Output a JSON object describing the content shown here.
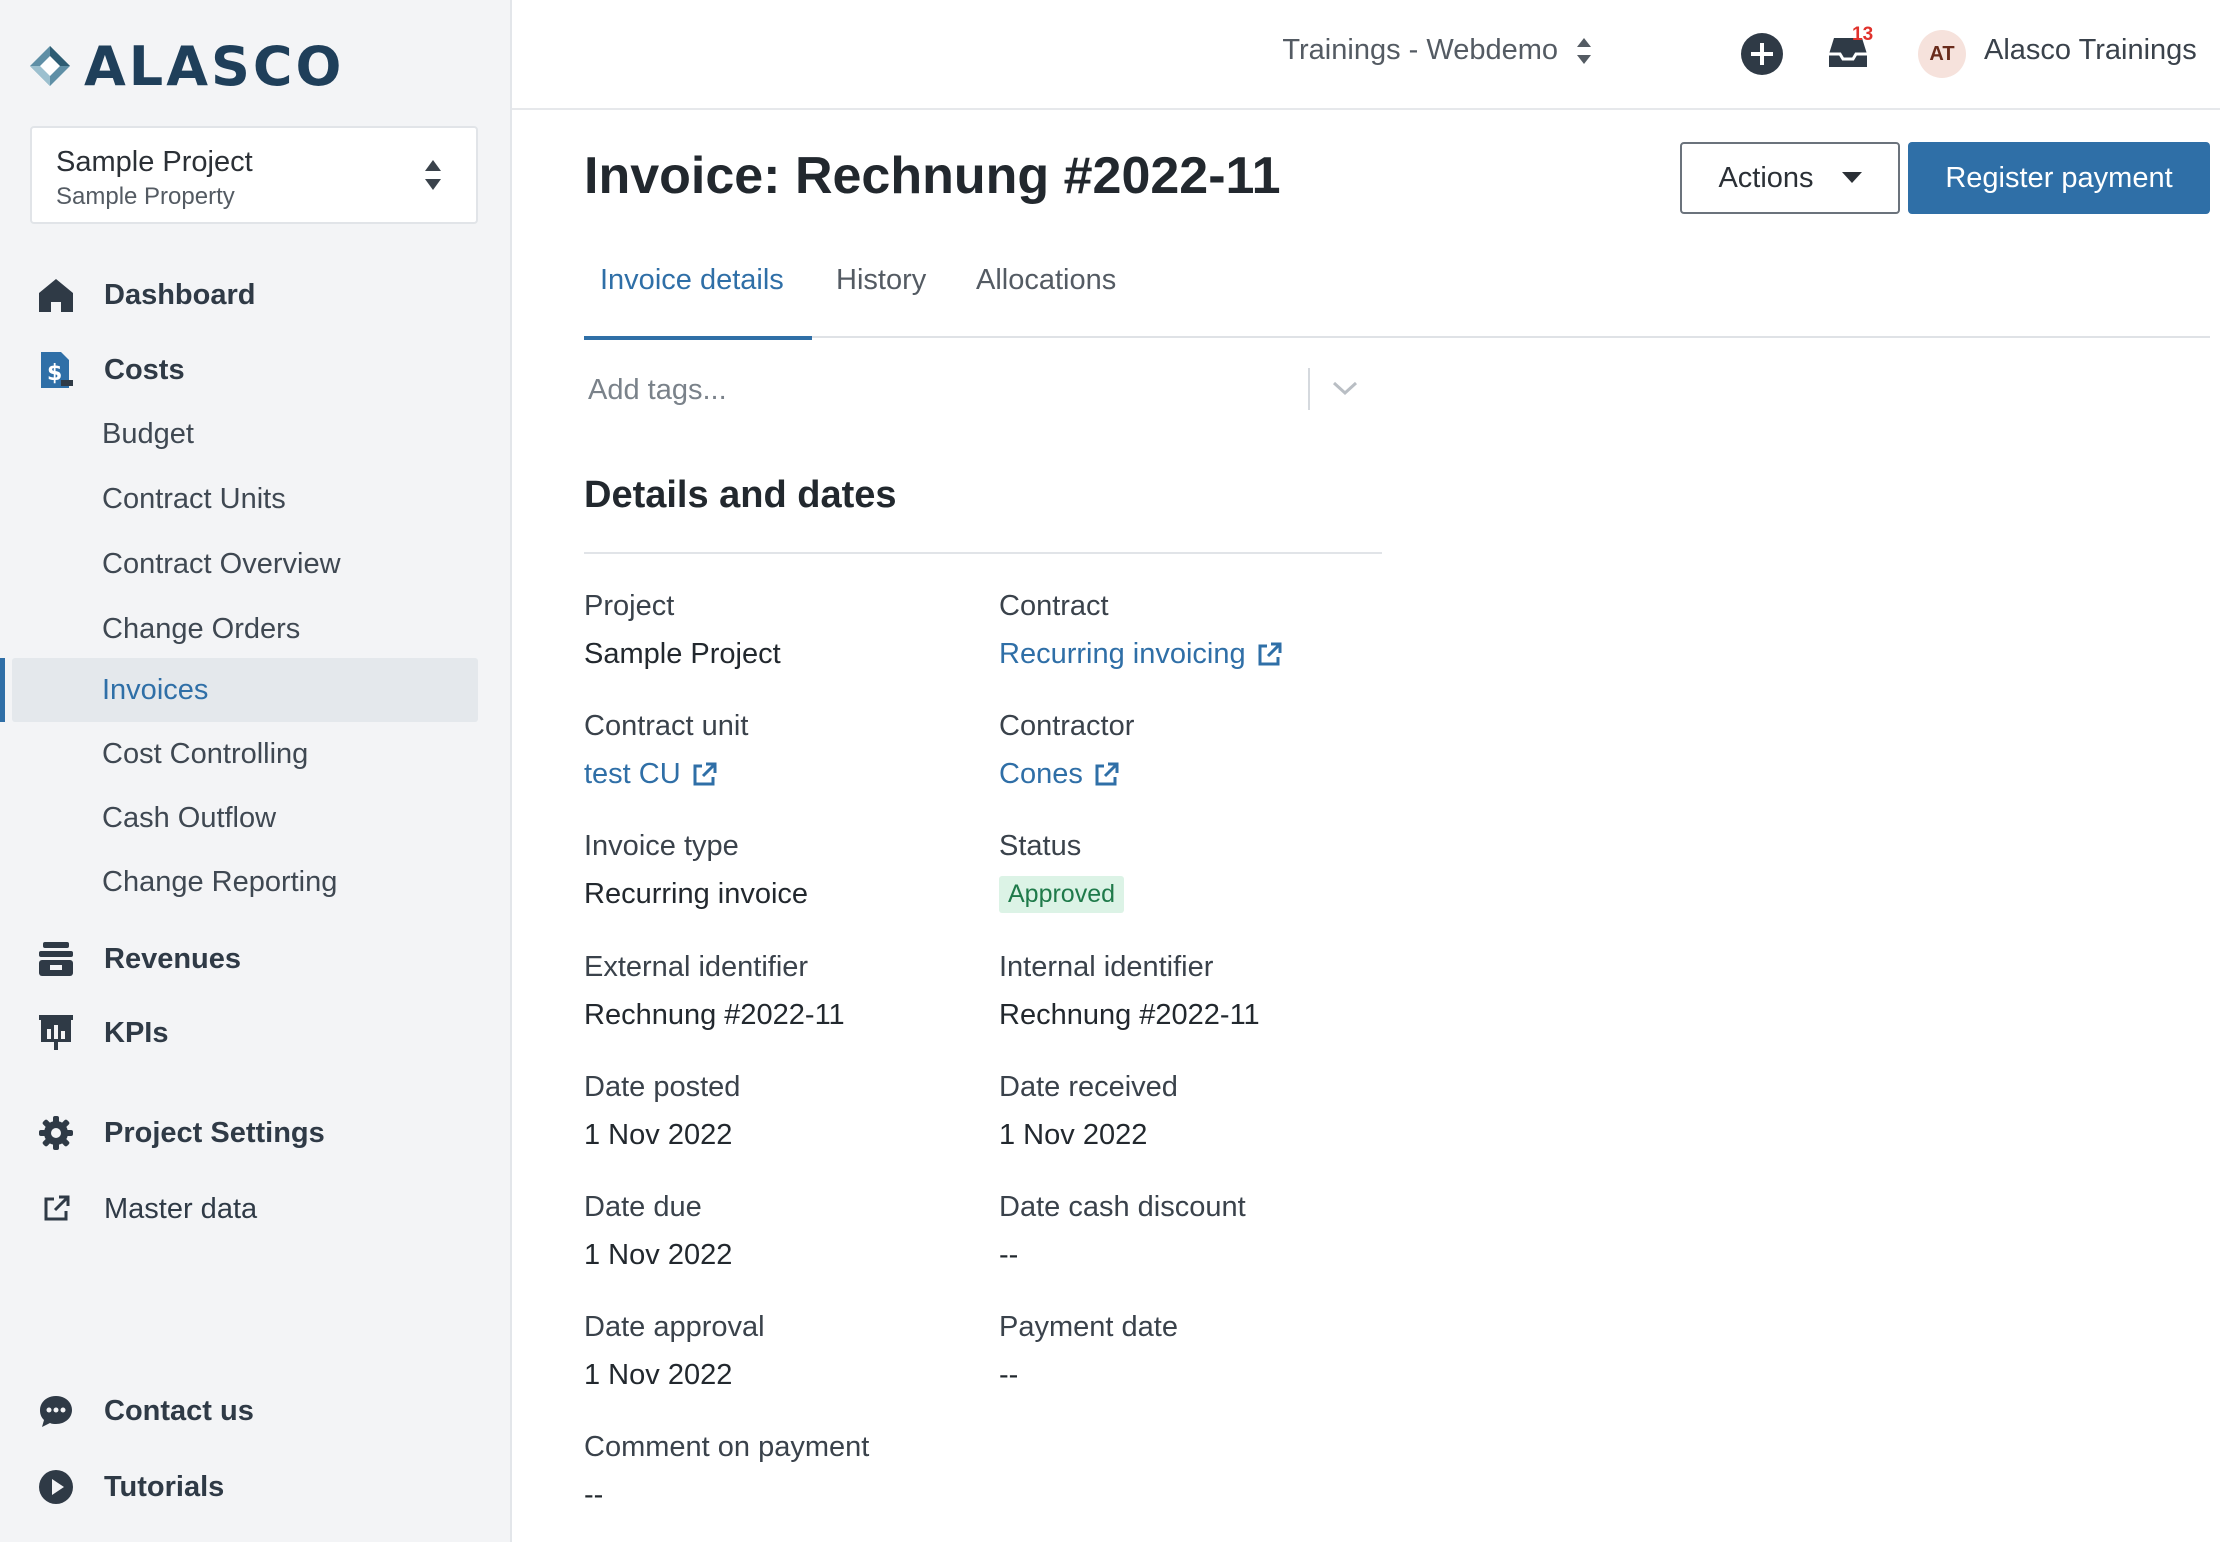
{
  "app": {
    "logo_text": "ALASCO"
  },
  "project": {
    "name": "Sample Project",
    "property": "Sample Property"
  },
  "nav": {
    "dashboard": "Dashboard",
    "costs": "Costs",
    "costs_items": [
      "Budget",
      "Contract Units",
      "Contract Overview",
      "Change Orders",
      "Invoices",
      "Cost Controlling",
      "Cash Outflow",
      "Change Reporting"
    ],
    "revenues": "Revenues",
    "kpis": "KPIs",
    "project_settings": "Project Settings",
    "master_data": "Master data",
    "contact_us": "Contact us",
    "tutorials": "Tutorials",
    "active_item": "Invoices"
  },
  "topbar": {
    "workspace": "Trainings - Webdemo",
    "inbox_count": "13",
    "avatar_initials": "AT",
    "user_name": "Alasco Trainings"
  },
  "page": {
    "title": "Invoice: Rechnung #2022-11",
    "actions_label": "Actions",
    "register_label": "Register payment",
    "tabs": [
      "Invoice details",
      "History",
      "Allocations"
    ],
    "tags_placeholder": "Add tags...",
    "section_title": "Details and dates"
  },
  "details": {
    "project_label": "Project",
    "project_value": "Sample Project",
    "contract_label": "Contract",
    "contract_value": "Recurring invoicing",
    "contract_unit_label": "Contract unit",
    "contract_unit_value": "test CU",
    "contractor_label": "Contractor",
    "contractor_value": "Cones",
    "invoice_type_label": "Invoice type",
    "invoice_type_value": "Recurring invoice",
    "status_label": "Status",
    "status_value": "Approved",
    "external_id_label": "External identifier",
    "external_id_value": "Rechnung #2022-11",
    "internal_id_label": "Internal identifier",
    "internal_id_value": "Rechnung #2022-11",
    "date_posted_label": "Date posted",
    "date_posted_value": "1 Nov 2022",
    "date_received_label": "Date received",
    "date_received_value": "1 Nov 2022",
    "date_due_label": "Date due",
    "date_due_value": "1 Nov 2022",
    "date_cash_discount_label": "Date cash discount",
    "date_cash_discount_value": "--",
    "date_approval_label": "Date approval",
    "date_approval_value": "1 Nov 2022",
    "payment_date_label": "Payment date",
    "payment_date_value": "--",
    "comment_label": "Comment on payment",
    "comment_value": "--"
  },
  "colors": {
    "primary": "#2f6fa7",
    "status_bg": "#dcf3e6",
    "status_text": "#1f7a4a",
    "badge": "#e0322c"
  }
}
